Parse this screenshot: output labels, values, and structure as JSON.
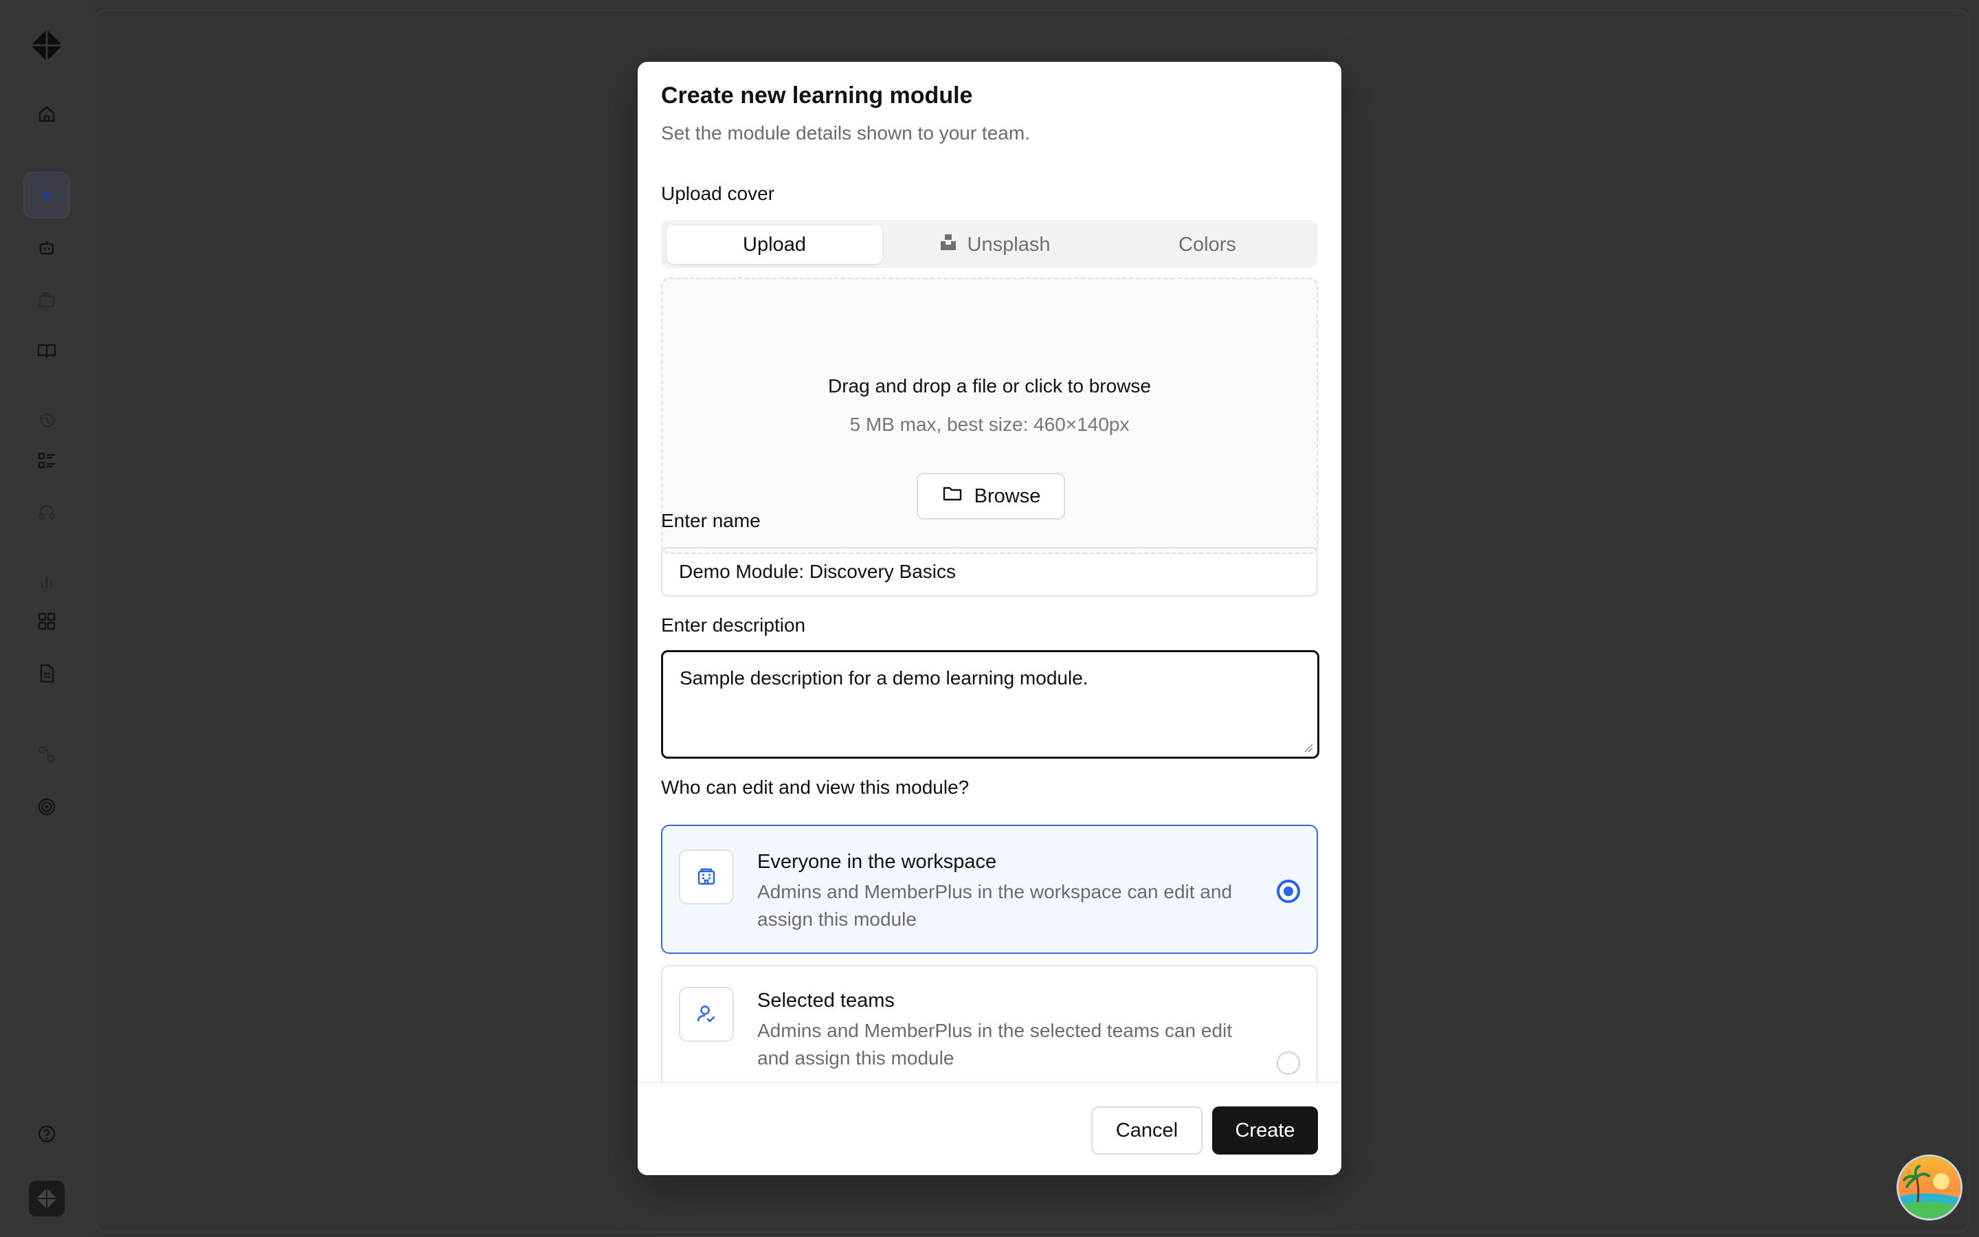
{
  "modal": {
    "title": "Create new learning module",
    "subtitle": "Set the module details shown to your team.",
    "upload_cover_label": "Upload cover",
    "tabs": [
      {
        "label": "Upload",
        "active": true
      },
      {
        "label": "Unsplash",
        "icon": "unsplash-icon",
        "active": false
      },
      {
        "label": "Colors",
        "active": false
      }
    ],
    "dropzone": {
      "title": "Drag and drop a file or click to browse",
      "hint": "5 MB max, best size: 460×140px",
      "browse_label": "Browse",
      "browse_icon": "folder-icon"
    },
    "name": {
      "label": "Enter name",
      "value": "Demo Module: Discovery Basics"
    },
    "description": {
      "label": "Enter description",
      "value": "Sample description for a demo learning module."
    },
    "access": {
      "question": "Who can edit and view this module?",
      "options": [
        {
          "title": "Everyone in the workspace",
          "description": "Admins and MemberPlus in the workspace can edit and assign this module",
          "icon": "building-icon",
          "selected": true
        },
        {
          "title": "Selected teams",
          "description": "Admins and MemberPlus in the selected teams can edit and assign this module",
          "icon": "user-check-icon",
          "selected": false
        }
      ]
    },
    "footer": {
      "cancel_label": "Cancel",
      "create_label": "Create"
    }
  },
  "sidebar": {
    "icons": [
      "home-icon",
      "sparkle-icon",
      "bot-icon",
      "briefcase-icon",
      "book-icon",
      "history-icon",
      "checklist-icon",
      "headset-icon",
      "bar-chart-icon",
      "grid-icon",
      "document-icon",
      "workflow-icon",
      "target-icon",
      "help-icon"
    ]
  },
  "colors": {
    "accent": "#2563eb",
    "selected_card_bg": "#f3f7ff",
    "primary_button": "#161616",
    "backdrop": "#333333"
  }
}
